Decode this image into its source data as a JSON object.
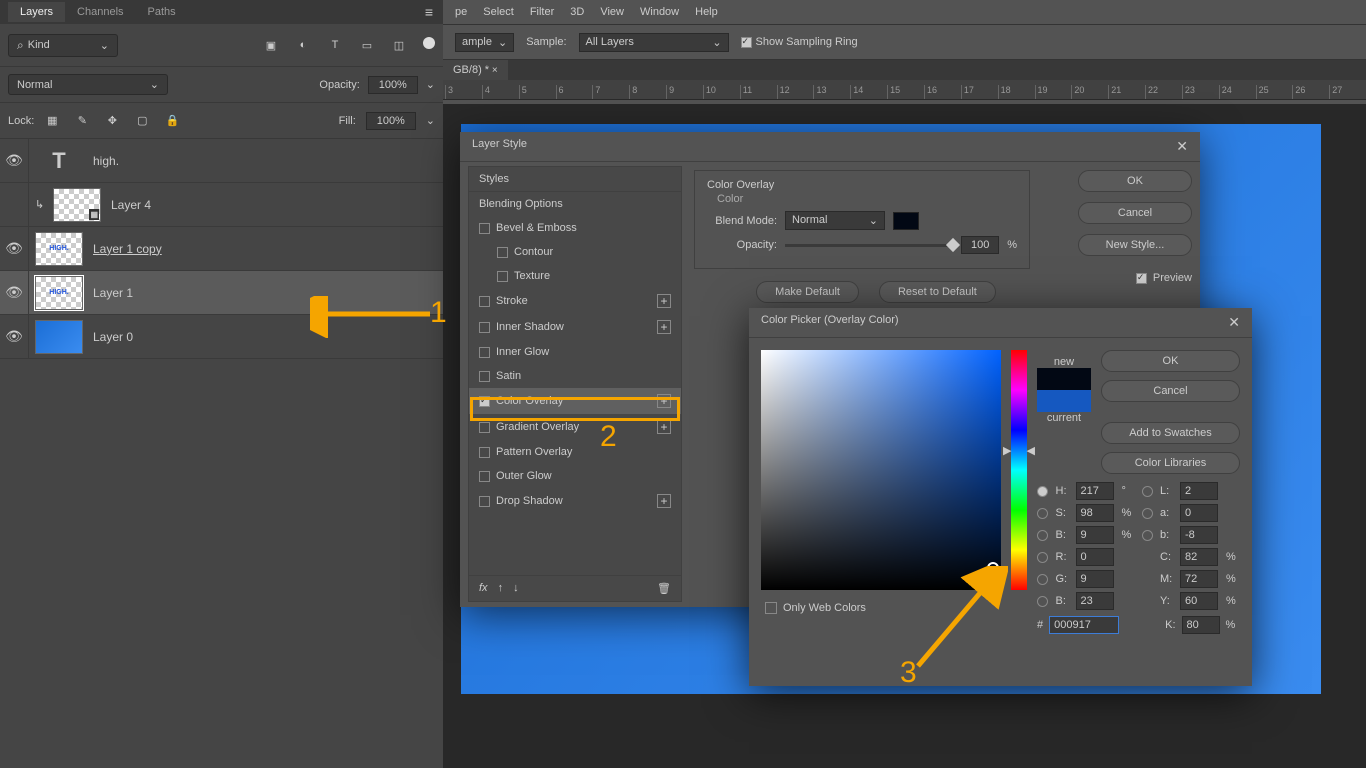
{
  "panel": {
    "tabs": [
      "Layers",
      "Channels",
      "Paths"
    ],
    "active_tab": "Layers",
    "kind_label": "Kind",
    "blend_mode": "Normal",
    "opacity_label": "Opacity:",
    "opacity_value": "100%",
    "lock_label": "Lock:",
    "fill_label": "Fill:",
    "fill_value": "100%"
  },
  "layers": [
    {
      "name": "high.",
      "type": "text"
    },
    {
      "name": "Layer 4",
      "type": "smart"
    },
    {
      "name": "Layer 1 copy",
      "type": "raster_trans",
      "underline": true
    },
    {
      "name": "Layer 1",
      "type": "raster_trans",
      "selected": true
    },
    {
      "name": "Layer 0",
      "type": "blue"
    }
  ],
  "menubar": [
    "pe",
    "Select",
    "Filter",
    "3D",
    "View",
    "Window",
    "Help"
  ],
  "options": {
    "sample_label_1": "ample",
    "sample_label_2": "Sample:",
    "sample_value": "All Layers",
    "sampling_ring": "Show Sampling Ring"
  },
  "doc_tab": "GB/8) *",
  "ruler_marks": [
    "3",
    "4",
    "5",
    "6",
    "7",
    "8",
    "9",
    "10",
    "11",
    "12",
    "13",
    "14",
    "15",
    "16",
    "17",
    "18",
    "19",
    "20",
    "21",
    "22",
    "23",
    "24",
    "25",
    "26",
    "27"
  ],
  "layer_style": {
    "title": "Layer Style",
    "styles_header": "Styles",
    "items": [
      {
        "label": "Blending Options"
      },
      {
        "label": "Bevel & Emboss",
        "cb": true
      },
      {
        "label": "Contour",
        "cb": true,
        "indent": true
      },
      {
        "label": "Texture",
        "cb": true,
        "indent": true
      },
      {
        "label": "Stroke",
        "cb": true,
        "plus": true
      },
      {
        "label": "Inner Shadow",
        "cb": true,
        "plus": true
      },
      {
        "label": "Inner Glow",
        "cb": true
      },
      {
        "label": "Satin",
        "cb": true
      },
      {
        "label": "Color Overlay",
        "cb": true,
        "checked": true,
        "plus": true,
        "sel": true
      },
      {
        "label": "Gradient Overlay",
        "cb": true,
        "plus": true
      },
      {
        "label": "Pattern Overlay",
        "cb": true
      },
      {
        "label": "Outer Glow",
        "cb": true
      },
      {
        "label": "Drop Shadow",
        "cb": true,
        "plus": true
      }
    ],
    "overlay_header": "Color Overlay",
    "color_label": "Color",
    "blend_label": "Blend Mode:",
    "blend_value": "Normal",
    "opacity_label": "Opacity:",
    "opacity_value": "100",
    "opacity_unit": "%",
    "make_default": "Make Default",
    "reset_default": "Reset to Default",
    "ok": "OK",
    "cancel": "Cancel",
    "new_style": "New Style...",
    "preview": "Preview"
  },
  "color_picker": {
    "title": "Color Picker (Overlay Color)",
    "new_label": "new",
    "current_label": "current",
    "ok": "OK",
    "cancel": "Cancel",
    "add_swatch": "Add to Swatches",
    "color_libs": "Color Libraries",
    "web_only": "Only Web Colors",
    "hex_label": "#",
    "hex_value": "000917",
    "H": "217",
    "S": "98",
    "B": "9",
    "R": "0",
    "G": "9",
    "Bl": "23",
    "L": "2",
    "a": "0",
    "b": "-8",
    "C": "82",
    "M": "72",
    "Y": "60",
    "K": "80",
    "deg": "°",
    "pct": "%"
  },
  "annotations": {
    "n1": "1",
    "n2": "2",
    "n3": "3"
  }
}
